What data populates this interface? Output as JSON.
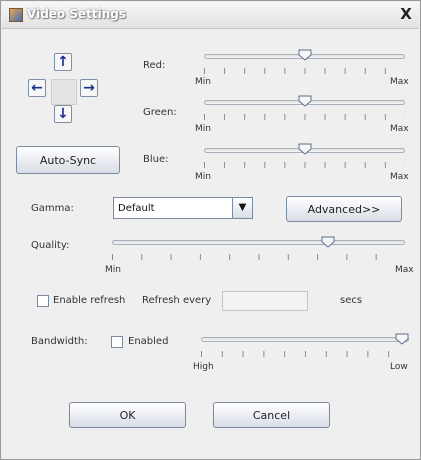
{
  "window": {
    "title": "Video Settings",
    "close_glyph": "X"
  },
  "arrows": {
    "up": "↑",
    "left": "←",
    "right": "→",
    "down": "↓"
  },
  "color": {
    "red": {
      "label": "Red:",
      "min": "Min",
      "max": "Max",
      "value_fraction": 0.5
    },
    "green": {
      "label": "Green:",
      "min": "Min",
      "max": "Max",
      "value_fraction": 0.5
    },
    "blue": {
      "label": "Blue:",
      "min": "Min",
      "max": "Max",
      "value_fraction": 0.5
    }
  },
  "buttons": {
    "auto_sync": "Auto-Sync",
    "advanced": "Advanced>>",
    "ok": "OK",
    "cancel": "Cancel"
  },
  "gamma": {
    "label": "Gamma:",
    "selected": "Default"
  },
  "quality": {
    "label": "Quality:",
    "min": "Min",
    "max": "Max",
    "value_fraction": 0.75
  },
  "refresh": {
    "enable_label": "Enable refresh",
    "every_label": "Refresh every",
    "value": "",
    "unit": "secs",
    "enabled": false
  },
  "bandwidth": {
    "label": "Bandwidth:",
    "enabled_label": "Enabled",
    "enabled": false,
    "high": "High",
    "low": "Low",
    "value_fraction": 1.0
  },
  "icons": {
    "app": "video-settings-app-icon",
    "close": "close-icon"
  }
}
